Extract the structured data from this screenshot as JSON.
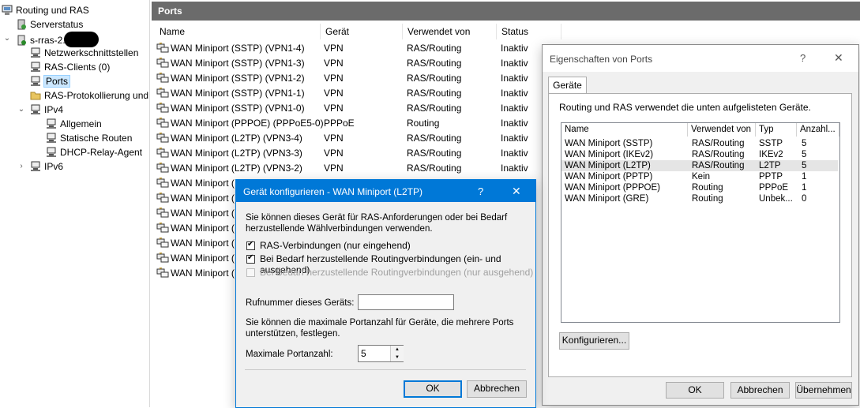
{
  "tree": {
    "root": "Routing und RAS",
    "server_status": "Serverstatus",
    "server": "s-rras-2.",
    "interfaces": "Netzwerkschnittstellen",
    "ras_clients": "RAS-Clients (0)",
    "ports": "Ports",
    "logging": "RAS-Protokollierung und",
    "ipv4": "IPv4",
    "general": "Allgemein",
    "static_routes": "Statische Routen",
    "dhcp_relay": "DHCP-Relay-Agent",
    "ipv6": "IPv6"
  },
  "ports": {
    "title": "Ports",
    "columns": [
      "Name",
      "Gerät",
      "Verwendet von",
      "Status"
    ],
    "rows": [
      [
        "WAN Miniport (SSTP) (VPN1-4)",
        "VPN",
        "RAS/Routing",
        "Inaktiv"
      ],
      [
        "WAN Miniport (SSTP) (VPN1-3)",
        "VPN",
        "RAS/Routing",
        "Inaktiv"
      ],
      [
        "WAN Miniport (SSTP) (VPN1-2)",
        "VPN",
        "RAS/Routing",
        "Inaktiv"
      ],
      [
        "WAN Miniport (SSTP) (VPN1-1)",
        "VPN",
        "RAS/Routing",
        "Inaktiv"
      ],
      [
        "WAN Miniport (SSTP) (VPN1-0)",
        "VPN",
        "RAS/Routing",
        "Inaktiv"
      ],
      [
        "WAN Miniport (PPPOE) (PPPoE5-0)",
        "PPPoE",
        "Routing",
        "Inaktiv"
      ],
      [
        "WAN Miniport (L2TP) (VPN3-4)",
        "VPN",
        "RAS/Routing",
        "Inaktiv"
      ],
      [
        "WAN Miniport (L2TP) (VPN3-3)",
        "VPN",
        "RAS/Routing",
        "Inaktiv"
      ],
      [
        "WAN Miniport (L2TP) (VPN3-2)",
        "VPN",
        "RAS/Routing",
        "Inaktiv"
      ],
      [
        "WAN Miniport (",
        "",
        "",
        ""
      ],
      [
        "WAN Miniport (",
        "",
        "",
        ""
      ],
      [
        "WAN Miniport (",
        "",
        "",
        ""
      ],
      [
        "WAN Miniport (",
        "",
        "",
        ""
      ],
      [
        "WAN Miniport (",
        "",
        "",
        ""
      ],
      [
        "WAN Miniport (",
        "",
        "",
        ""
      ],
      [
        "WAN Miniport (",
        "",
        "",
        ""
      ]
    ]
  },
  "props": {
    "title": "Eigenschaften von Ports",
    "help": "?",
    "close": "✕",
    "tab": "Geräte",
    "description": "Routing und RAS verwendet die unten aufgelisteten Geräte.",
    "columns": [
      "Name",
      "Verwendet von",
      "Typ",
      "Anzahl..."
    ],
    "devices": [
      [
        "WAN Miniport (SSTP)",
        "RAS/Routing",
        "SSTP",
        "5"
      ],
      [
        "WAN Miniport (IKEv2)",
        "RAS/Routing",
        "IKEv2",
        "5"
      ],
      [
        "WAN Miniport (L2TP)",
        "RAS/Routing",
        "L2TP",
        "5"
      ],
      [
        "WAN Miniport (PPTP)",
        "Kein",
        "PPTP",
        "1"
      ],
      [
        "WAN Miniport (PPPOE)",
        "Routing",
        "PPPoE",
        "1"
      ],
      [
        "WAN Miniport (GRE)",
        "Routing",
        "Unbek...",
        "0"
      ]
    ],
    "configure": "Konfigurieren...",
    "ok": "OK",
    "cancel": "Abbrechen",
    "apply": "Übernehmen"
  },
  "config": {
    "title": "Gerät konfigurieren - WAN Miniport (L2TP)",
    "help": "?",
    "close": "✕",
    "intro": "Sie können dieses Gerät für RAS-Anforderungen oder bei Bedarf herzustellende Wählverbindungen verwenden.",
    "opt1": "RAS-Verbindungen (nur eingehend)",
    "opt2": "Bei Bedarf herzustellende Routingverbindungen (ein- und ausgehend)",
    "opt3": "Bei Bedarf herzustellende Routingverbindungen (nur ausgehend)",
    "phone_label": "Rufnummer dieses Geräts:",
    "phone_value": "",
    "max_text": "Sie können die maximale Portanzahl für Geräte, die mehrere Ports unterstützen, festlegen.",
    "max_label": "Maximale Portanzahl:",
    "max_value": "5",
    "ok": "OK",
    "cancel": "Abbrechen"
  },
  "colors": {
    "accent": "#0078d7",
    "header": "#6b6b6b",
    "selection": "#cce8ff"
  }
}
